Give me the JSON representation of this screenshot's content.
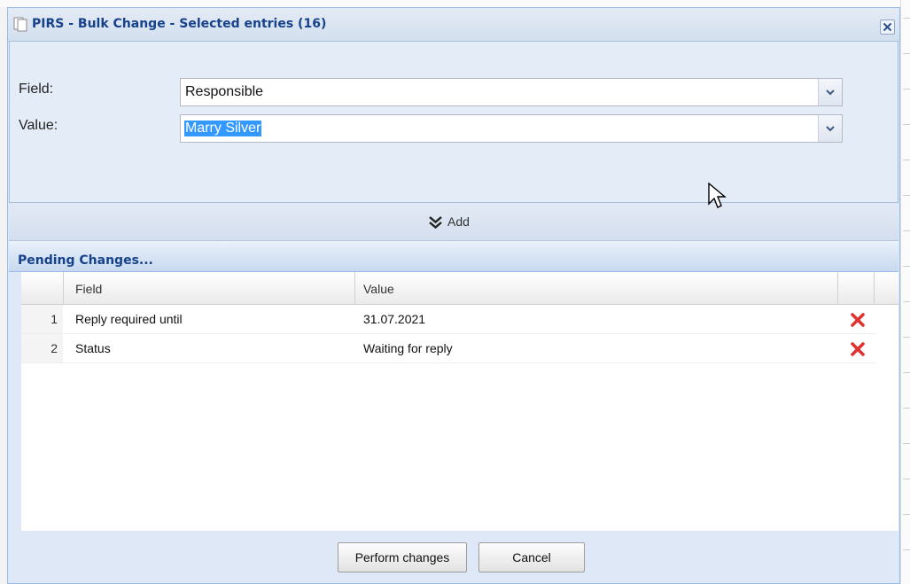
{
  "dialog": {
    "title": "PIRS - Bulk Change - Selected entries (16)"
  },
  "form": {
    "field_label": "Field:",
    "field_value": "Responsible",
    "value_label": "Value:",
    "value_value": "Marry Silver"
  },
  "add_button": {
    "label": "Add"
  },
  "pending": {
    "title": "Pending Changes...",
    "columns": [
      "Field",
      "Value"
    ],
    "rows": [
      {
        "num": "1",
        "field": "Reply required until",
        "value": "31.07.2021"
      },
      {
        "num": "2",
        "field": "Status",
        "value": "Waiting for reply"
      }
    ]
  },
  "buttons": {
    "perform": "Perform changes",
    "cancel": "Cancel"
  },
  "colors": {
    "title_text": "#15428b",
    "window_border": "#99bbe8",
    "selection": "#3399ff",
    "delete_icon": "#e03030"
  },
  "icons": {
    "title": "pages-icon",
    "close": "close-icon",
    "dropdown": "chevron-down-icon",
    "add": "double-chevron-down-icon",
    "delete": "red-x-icon"
  }
}
